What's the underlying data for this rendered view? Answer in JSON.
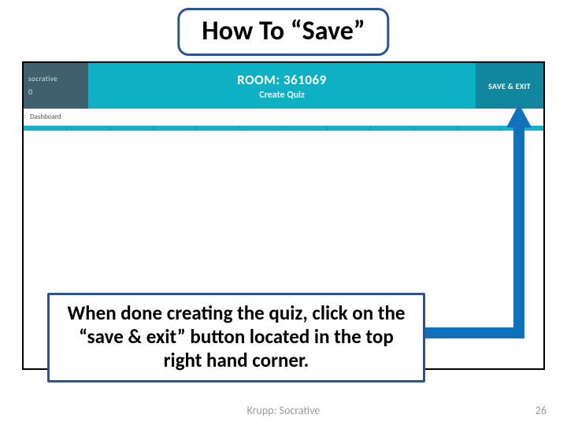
{
  "title": "How To “Save”",
  "app": {
    "brand": "socrative",
    "count_label": "0",
    "room_label": "ROOM: 361069",
    "subtitle": "Create Quiz",
    "save_exit": "SAVE & EXIT",
    "breadcrumb": "Dashboard"
  },
  "instruction": "When done creating the quiz, click on the “save & exit” button located in the top right hand corner.",
  "footer": "Krupp: Socrative",
  "page_number": "26"
}
